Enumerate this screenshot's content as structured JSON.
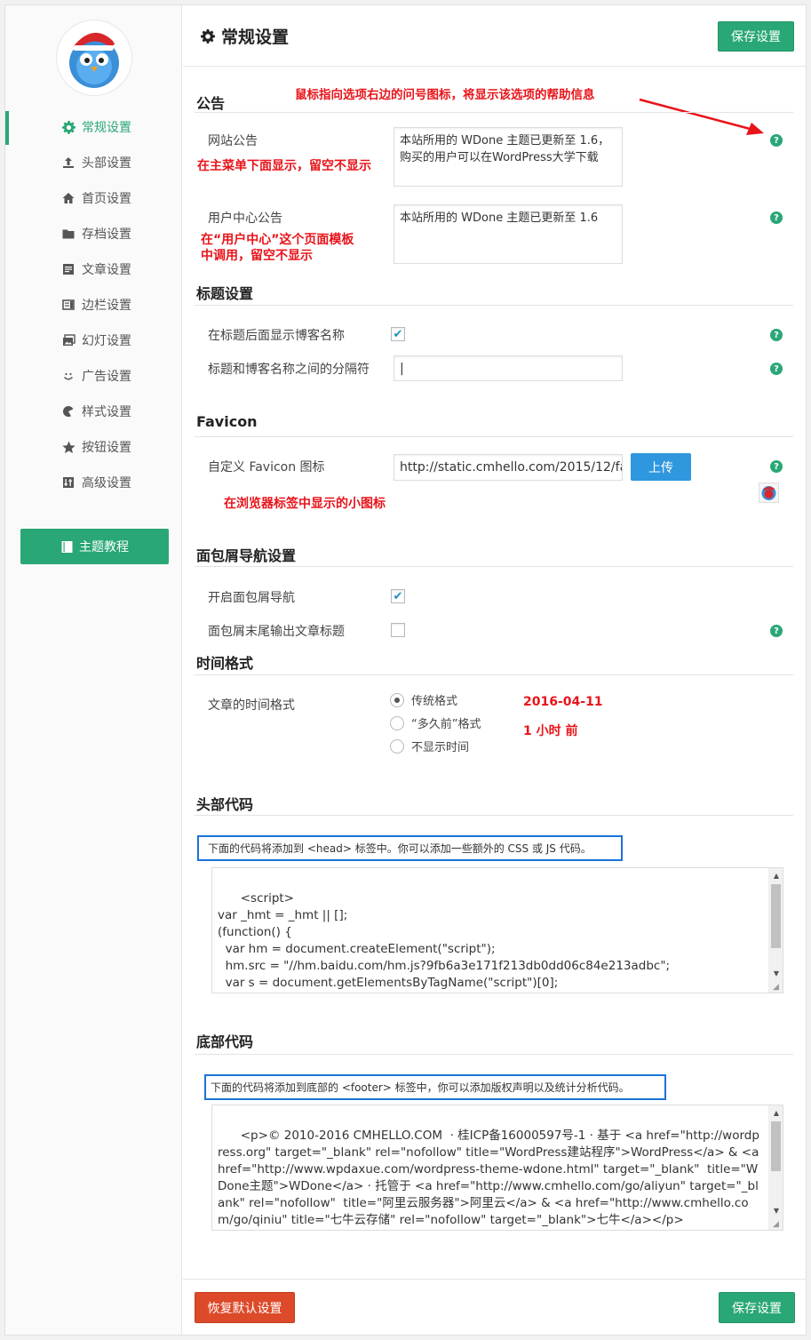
{
  "sidebar": {
    "avatar_alt": "avatar",
    "items": [
      {
        "label": "常规设置",
        "icon": "gear-icon",
        "active": true
      },
      {
        "label": "头部设置",
        "icon": "upload-icon"
      },
      {
        "label": "首页设置",
        "icon": "home-icon"
      },
      {
        "label": "存档设置",
        "icon": "folder-icon"
      },
      {
        "label": "文章设置",
        "icon": "article-icon"
      },
      {
        "label": "边栏设置",
        "icon": "sidebar-icon"
      },
      {
        "label": "幻灯设置",
        "icon": "slides-icon"
      },
      {
        "label": "广告设置",
        "icon": "smile-icon"
      },
      {
        "label": "样式设置",
        "icon": "palette-icon"
      },
      {
        "label": "按钮设置",
        "icon": "star-icon"
      },
      {
        "label": "高级设置",
        "icon": "advanced-icon"
      }
    ],
    "tutorial_label": "主题教程"
  },
  "header": {
    "title": "常规设置",
    "save_label": "保存设置"
  },
  "annotation_top": "鼠标指向选项右边的问号图标，将显示该选项的帮助信息",
  "sections": {
    "notice": {
      "title": "公告",
      "site_notice_label": "网站公告",
      "site_notice_value": "本站所用的 WDone 主题已更新至 1.6，购买的用户可以在WordPress大学下载",
      "site_notice_note": "在主菜单下面显示，留空不显示",
      "user_notice_label": "用户中心公告",
      "user_notice_value": "本站所用的 WDone 主题已更新至 1.6",
      "user_notice_note_1": "在“用户中心”这个页面模板",
      "user_notice_note_2": "中调用，留空不显示"
    },
    "title_settings": {
      "title": "标题设置",
      "show_blog_name_label": "在标题后面显示博客名称",
      "show_blog_name_checked": "✔",
      "separator_label": "标题和博客名称之间的分隔符",
      "separator_value": "|"
    },
    "favicon": {
      "title": "Favicon",
      "label": "自定义 Favicon 图标",
      "value": "http://static.cmhello.com/2015/12/fa",
      "upload_label": "上传",
      "note": "在浏览器标签中显示的小图标"
    },
    "breadcrumb": {
      "title": "面包屑导航设置",
      "enable_label": "开启面包屑导航",
      "enable_checked": "✔",
      "output_title_label": "面包屑末尾输出文章标题"
    },
    "time_format": {
      "title": "时间格式",
      "label": "文章的时间格式",
      "options": [
        "传统格式",
        "“多久前”格式",
        "不显示时间"
      ],
      "selected": 0,
      "example_date": "2016-04-11",
      "example_ago": "1 小时 前"
    },
    "head_code": {
      "title": "头部代码",
      "hint": "下面的代码将添加到 <head> 标签中。你可以添加一些额外的 CSS 或 JS 代码。",
      "code": "<script>\nvar _hmt = _hmt || [];\n(function() {\n  var hm = document.createElement(\"script\");\n  hm.src = \"//hm.baidu.com/hm.js?9fb6a3e171f213db0dd06c84e213adbc\";\n  var s = document.getElementsByTagName(\"script\")[0];\n  s.parentNode.insertBefore(hm, s);"
    },
    "footer_code": {
      "title": "底部代码",
      "hint": "下面的代码将添加到底部的 <footer> 标签中，你可以添加版权声明以及统计分析代码。",
      "code": "<p>© 2010-2016 CMHELLO.COM  · 桂ICP备16000597号-1 · 基于 <a href=\"http://wordpress.org\" target=\"_blank\" rel=\"nofollow\" title=\"WordPress建站程序\">WordPress</a> & <a href=\"http://www.wpdaxue.com/wordpress-theme-wdone.html\" target=\"_blank\"  title=\"WDone主题\">WDone</a> · 托管于 <a href=\"http://www.cmhello.com/go/aliyun\" target=\"_blank\" rel=\"nofollow\"  title=\"阿里云服务器\">阿里云</a> & <a href=\"http://www.cmhello.com/go/qiniu\" title=\"七牛云存储\" rel=\"nofollow\" target=\"_blank\">七牛</a></p>"
    }
  },
  "footer": {
    "reset_label": "恢复默认设置",
    "save_label": "保存设置"
  },
  "colors": {
    "accent": "#2aa776",
    "annotation_red": "#e8141a",
    "highlight_blue": "#1a73d9",
    "upload_blue": "#2f97dd",
    "reset_red": "#dc4a2a"
  }
}
